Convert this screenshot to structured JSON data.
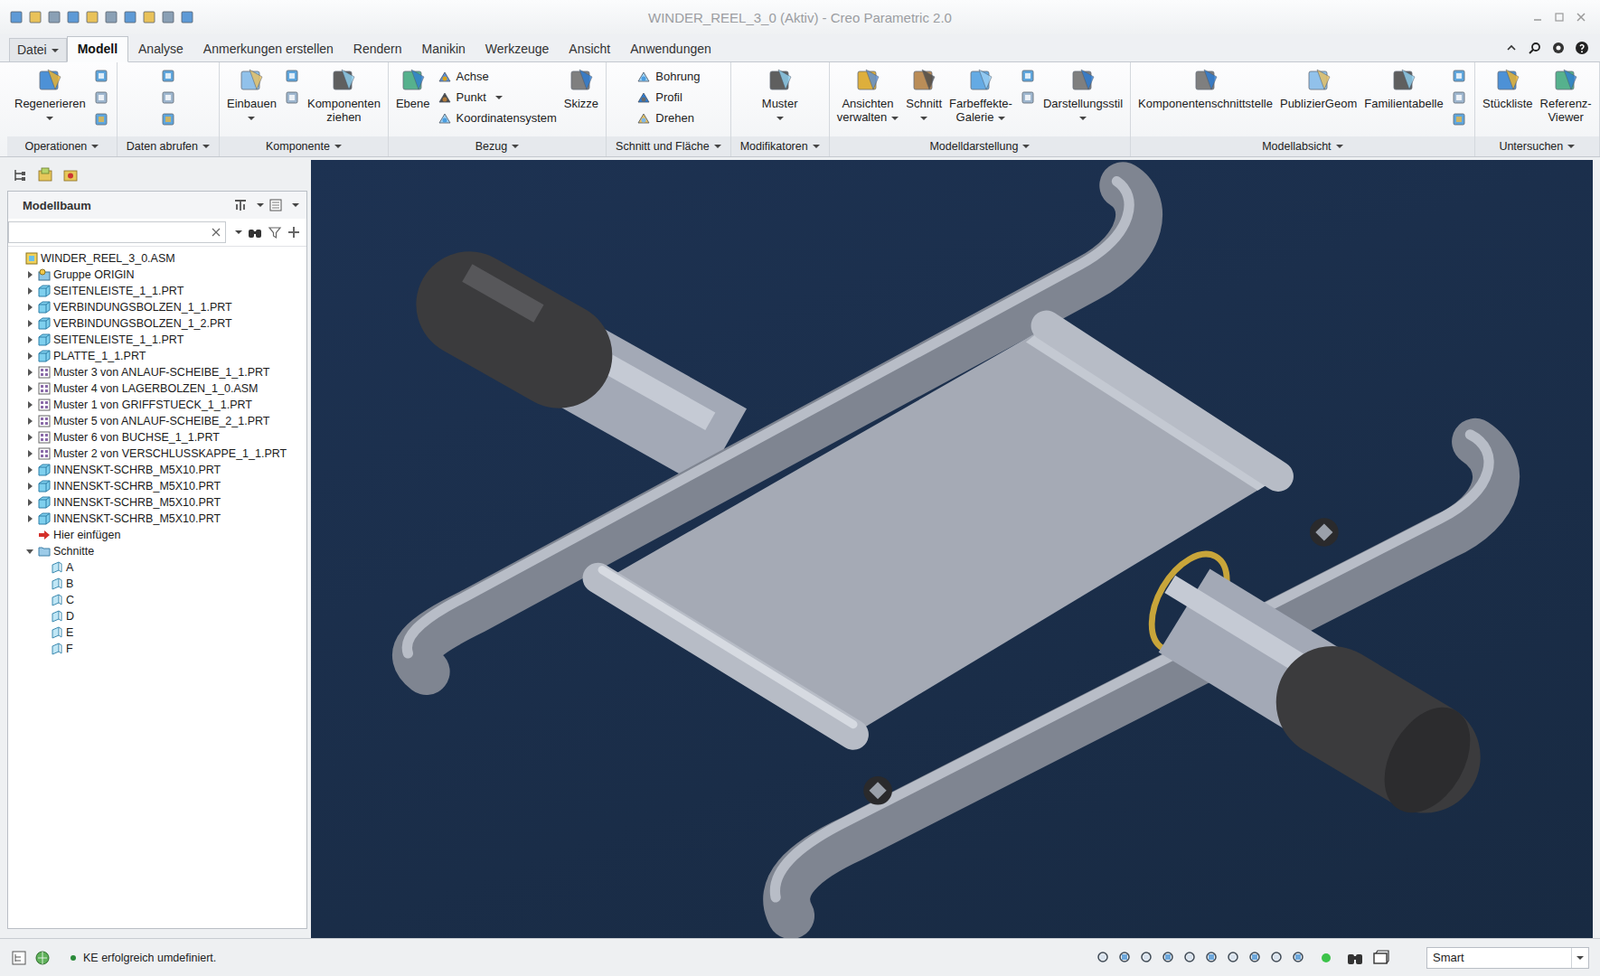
{
  "window": {
    "title": "WINDER_REEL_3_0 (Aktiv) - Creo Parametric 2.0"
  },
  "menu_tabs": [
    {
      "label": "Datei",
      "selected": false,
      "dropdown": true
    },
    {
      "label": "Modell",
      "selected": true,
      "dropdown": false
    },
    {
      "label": "Analyse",
      "selected": false,
      "dropdown": false
    },
    {
      "label": "Anmerkungen erstellen",
      "selected": false,
      "dropdown": false
    },
    {
      "label": "Rendern",
      "selected": false,
      "dropdown": false
    },
    {
      "label": "Manikin",
      "selected": false,
      "dropdown": false
    },
    {
      "label": "Werkzeuge",
      "selected": false,
      "dropdown": false
    },
    {
      "label": "Ansicht",
      "selected": false,
      "dropdown": false
    },
    {
      "label": "Anwendungen",
      "selected": false,
      "dropdown": false
    }
  ],
  "ribbon_groups": [
    {
      "label": "Operationen",
      "items": [
        {
          "kind": "large",
          "lines": [
            "Regenerieren"
          ],
          "dropdown": true
        }
      ]
    },
    {
      "label": "Daten abrufen",
      "items": []
    },
    {
      "label": "Komponente",
      "items": [
        {
          "kind": "large",
          "lines": [
            "Einbauen"
          ],
          "dropdown": true
        },
        {
          "kind": "large",
          "lines": [
            "Komponenten",
            "ziehen"
          ],
          "dropdown": false
        }
      ]
    },
    {
      "label": "Bezug",
      "items": [
        {
          "kind": "large",
          "lines": [
            "Ebene"
          ],
          "dropdown": false
        },
        {
          "kind": "small",
          "lines": [
            "Achse"
          ],
          "dropdown": false
        },
        {
          "kind": "small",
          "lines": [
            "Punkt"
          ],
          "dropdown": true
        },
        {
          "kind": "small",
          "lines": [
            "Koordinatensystem"
          ],
          "dropdown": false
        },
        {
          "kind": "large",
          "lines": [
            "Skizze"
          ],
          "dropdown": false
        }
      ]
    },
    {
      "label": "Schnitt und Fläche",
      "items": [
        {
          "kind": "small",
          "lines": [
            "Bohrung"
          ],
          "dropdown": false
        },
        {
          "kind": "small",
          "lines": [
            "Profil"
          ],
          "dropdown": false
        },
        {
          "kind": "small",
          "lines": [
            "Drehen"
          ],
          "dropdown": false
        }
      ]
    },
    {
      "label": "Modifikatoren",
      "items": [
        {
          "kind": "large",
          "lines": [
            "Muster"
          ],
          "dropdown": true
        }
      ]
    },
    {
      "label": "Modelldarstellung",
      "items": [
        {
          "kind": "large",
          "lines": [
            "Ansichten",
            "verwalten"
          ],
          "dropdown": true
        },
        {
          "kind": "large",
          "lines": [
            "Schnitt"
          ],
          "dropdown": true
        },
        {
          "kind": "large",
          "lines": [
            "Farbeffekte-",
            "Galerie"
          ],
          "dropdown": true
        },
        {
          "kind": "large",
          "lines": [
            "Darstellungsstil"
          ],
          "dropdown": true
        }
      ]
    },
    {
      "label": "Modellabsicht",
      "items": [
        {
          "kind": "large",
          "lines": [
            "Komponentenschnittstelle"
          ],
          "dropdown": false
        },
        {
          "kind": "large",
          "lines": [
            "PublizierGeom"
          ],
          "dropdown": false
        },
        {
          "kind": "large",
          "lines": [
            "Familientabelle"
          ],
          "dropdown": false
        }
      ]
    },
    {
      "label": "Untersuchen",
      "items": [
        {
          "kind": "large",
          "lines": [
            "Stückliste"
          ],
          "dropdown": false
        },
        {
          "kind": "large",
          "lines": [
            "Referenz-",
            "Viewer"
          ],
          "dropdown": false
        }
      ]
    }
  ],
  "model_tree": {
    "title": "Modellbaum",
    "search": {
      "value": ""
    },
    "items": [
      {
        "label": "WINDER_REEL_3_0.ASM",
        "icon": "asm",
        "level": 0,
        "expandable": false,
        "expanded": false
      },
      {
        "label": "Gruppe ORIGIN",
        "icon": "group",
        "level": 1,
        "expandable": true,
        "expanded": false
      },
      {
        "label": "SEITENLEISTE_1_1.PRT",
        "icon": "part",
        "level": 1,
        "expandable": true,
        "expanded": false
      },
      {
        "label": "VERBINDUNGSBOLZEN_1_1.PRT",
        "icon": "part",
        "level": 1,
        "expandable": true,
        "expanded": false
      },
      {
        "label": "VERBINDUNGSBOLZEN_1_2.PRT",
        "icon": "part",
        "level": 1,
        "expandable": true,
        "expanded": false
      },
      {
        "label": "SEITENLEISTE_1_1.PRT",
        "icon": "part",
        "level": 1,
        "expandable": true,
        "expanded": false
      },
      {
        "label": "PLATTE_1_1.PRT",
        "icon": "part",
        "level": 1,
        "expandable": true,
        "expanded": false
      },
      {
        "label": "Muster 3 von ANLAUF-SCHEIBE_1_1.PRT",
        "icon": "pattern",
        "level": 1,
        "expandable": true,
        "expanded": false
      },
      {
        "label": "Muster 4 von LAGERBOLZEN_1_0.ASM",
        "icon": "pattern",
        "level": 1,
        "expandable": true,
        "expanded": false
      },
      {
        "label": "Muster 1 von GRIFFSTUECK_1_1.PRT",
        "icon": "pattern",
        "level": 1,
        "expandable": true,
        "expanded": false
      },
      {
        "label": "Muster 5 von ANLAUF-SCHEIBE_2_1.PRT",
        "icon": "pattern",
        "level": 1,
        "expandable": true,
        "expanded": false
      },
      {
        "label": "Muster 6 von BUCHSE_1_1.PRT",
        "icon": "pattern",
        "level": 1,
        "expandable": true,
        "expanded": false
      },
      {
        "label": "Muster 2 von VERSCHLUSSKAPPE_1_1.PRT",
        "icon": "pattern",
        "level": 1,
        "expandable": true,
        "expanded": false
      },
      {
        "label": "INNENSKT-SCHRB_M5X10.PRT",
        "icon": "part",
        "level": 1,
        "expandable": true,
        "expanded": false
      },
      {
        "label": "INNENSKT-SCHRB_M5X10.PRT",
        "icon": "part",
        "level": 1,
        "expandable": true,
        "expanded": false
      },
      {
        "label": "INNENSKT-SCHRB_M5X10.PRT",
        "icon": "part",
        "level": 1,
        "expandable": true,
        "expanded": false
      },
      {
        "label": "INNENSKT-SCHRB_M5X10.PRT",
        "icon": "part",
        "level": 1,
        "expandable": true,
        "expanded": false
      },
      {
        "label": "Hier einfügen",
        "icon": "insert",
        "level": 1,
        "expandable": false,
        "expanded": false
      },
      {
        "label": "Schnitte",
        "icon": "folder",
        "level": 1,
        "expandable": true,
        "expanded": true
      },
      {
        "label": "A",
        "icon": "section",
        "level": 2,
        "expandable": false,
        "expanded": false
      },
      {
        "label": "B",
        "icon": "section",
        "level": 2,
        "expandable": false,
        "expanded": false
      },
      {
        "label": "C",
        "icon": "section",
        "level": 2,
        "expandable": false,
        "expanded": false
      },
      {
        "label": "D",
        "icon": "section",
        "level": 2,
        "expandable": false,
        "expanded": false
      },
      {
        "label": "E",
        "icon": "section",
        "level": 2,
        "expandable": false,
        "expanded": false
      },
      {
        "label": "F",
        "icon": "section",
        "level": 2,
        "expandable": false,
        "expanded": false
      }
    ]
  },
  "status_bar": {
    "message": "KE erfolgreich umdefiniert.",
    "filter": "Smart"
  }
}
